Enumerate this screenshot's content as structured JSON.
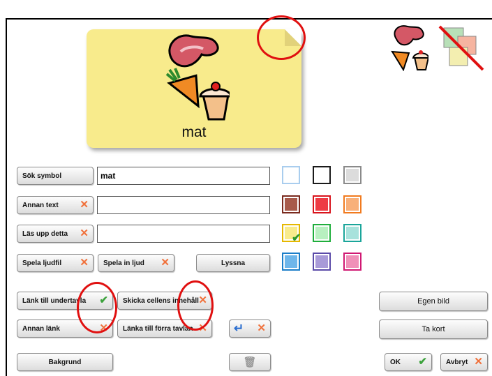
{
  "card": {
    "word": "mat"
  },
  "fields": {
    "search_label": "Sök symbol",
    "search_value": "mat",
    "other_text_label": "Annan text",
    "other_text_value": "",
    "read_aloud_label": "Läs upp detta",
    "read_aloud_value": ""
  },
  "sound": {
    "play_label": "Spela ljudfil",
    "record_label": "Spela in ljud",
    "listen_label": "Lyssna"
  },
  "links": {
    "sub_board_label": "Länk till undertavla",
    "send_content_label": "Skicka cellens innehåll",
    "other_link_label": "Annan länk",
    "prev_board_label": "Länka till förra tavlan"
  },
  "actions": {
    "background_label": "Bakgrund",
    "own_image_label": "Egen bild",
    "take_photo_label": "Ta kort",
    "ok_label": "OK",
    "cancel_label": "Avbryt"
  },
  "colors": {
    "swatches": [
      {
        "name": "white",
        "border": "#a9cdee",
        "fill": "#ffffff"
      },
      {
        "name": "black",
        "border": "#1a1a1a",
        "fill": "#ffffff"
      },
      {
        "name": "gray",
        "border": "#8a8a8a",
        "fill": "#dcdcdc"
      },
      {
        "name": "brown",
        "border": "#7a2a1e",
        "fill": "#a85a4a"
      },
      {
        "name": "red",
        "border": "#d8141c",
        "fill": "#ee3b44"
      },
      {
        "name": "orange",
        "border": "#f17a1e",
        "fill": "#f8b07a"
      },
      {
        "name": "yellow",
        "border": "#e6b800",
        "fill": "#f8eb8c"
      },
      {
        "name": "green",
        "border": "#1fae3c",
        "fill": "#b8f0c0"
      },
      {
        "name": "teal",
        "border": "#1aa59a",
        "fill": "#a8e2dc"
      },
      {
        "name": "blue",
        "border": "#1c7ec8",
        "fill": "#6eb6ea"
      },
      {
        "name": "purple",
        "border": "#5a4aa8",
        "fill": "#a89ad8"
      },
      {
        "name": "pink",
        "border": "#d01872",
        "fill": "#f090b8"
      }
    ],
    "selected": "yellow"
  }
}
